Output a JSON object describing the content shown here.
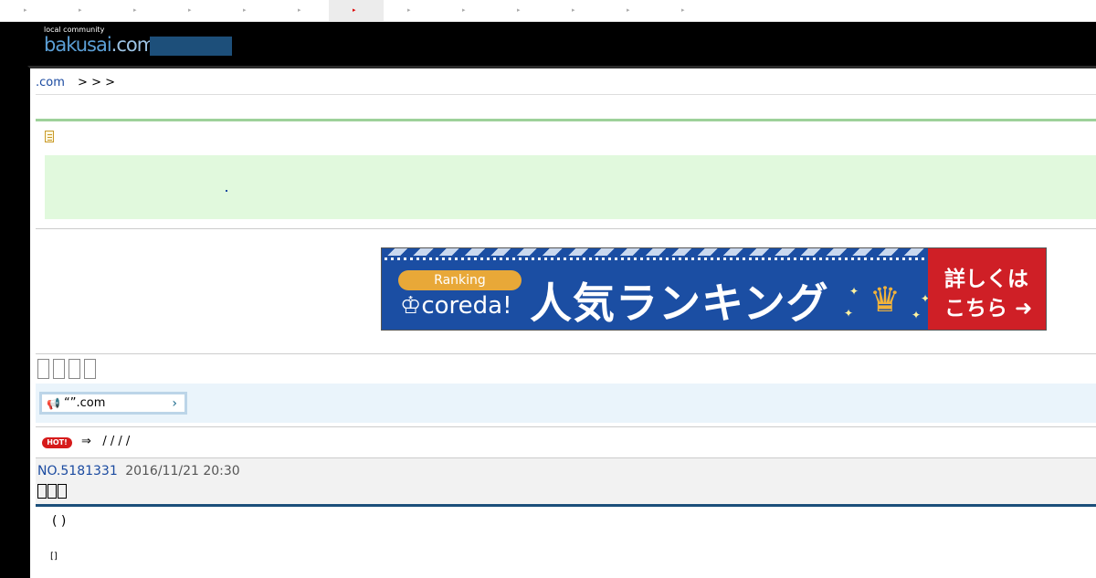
{
  "top_nav": {
    "tab_count": 13,
    "active_index": 6
  },
  "logo": {
    "tagline": "local community",
    "name_part1": "bakusai",
    "name_part2": ".com"
  },
  "breadcrumb": {
    "home": ".com",
    "separators": "> > >"
  },
  "banner": {
    "pill": "Ranking",
    "brand": "coreda!",
    "headline": "人気ランキング",
    "cta_line1": "詳しくは",
    "cta_line2": "こちら"
  },
  "notice": {
    "text": "“”.com",
    "chevron": "›"
  },
  "hot": {
    "badge": "HOT!",
    "arrow": "⇒",
    "text": "/ / / /"
  },
  "post": {
    "number": "NO.5181331",
    "datetime": "2016/11/21 20:30",
    "body_line1": "( )",
    "body_line2": "[]"
  },
  "colors": {
    "accent_green": "#9dd19a",
    "post_line": "#1b4f7a",
    "hot_red": "#d61a1a",
    "banner_blue": "#1b4ea3",
    "banner_red": "#cf1f26"
  }
}
